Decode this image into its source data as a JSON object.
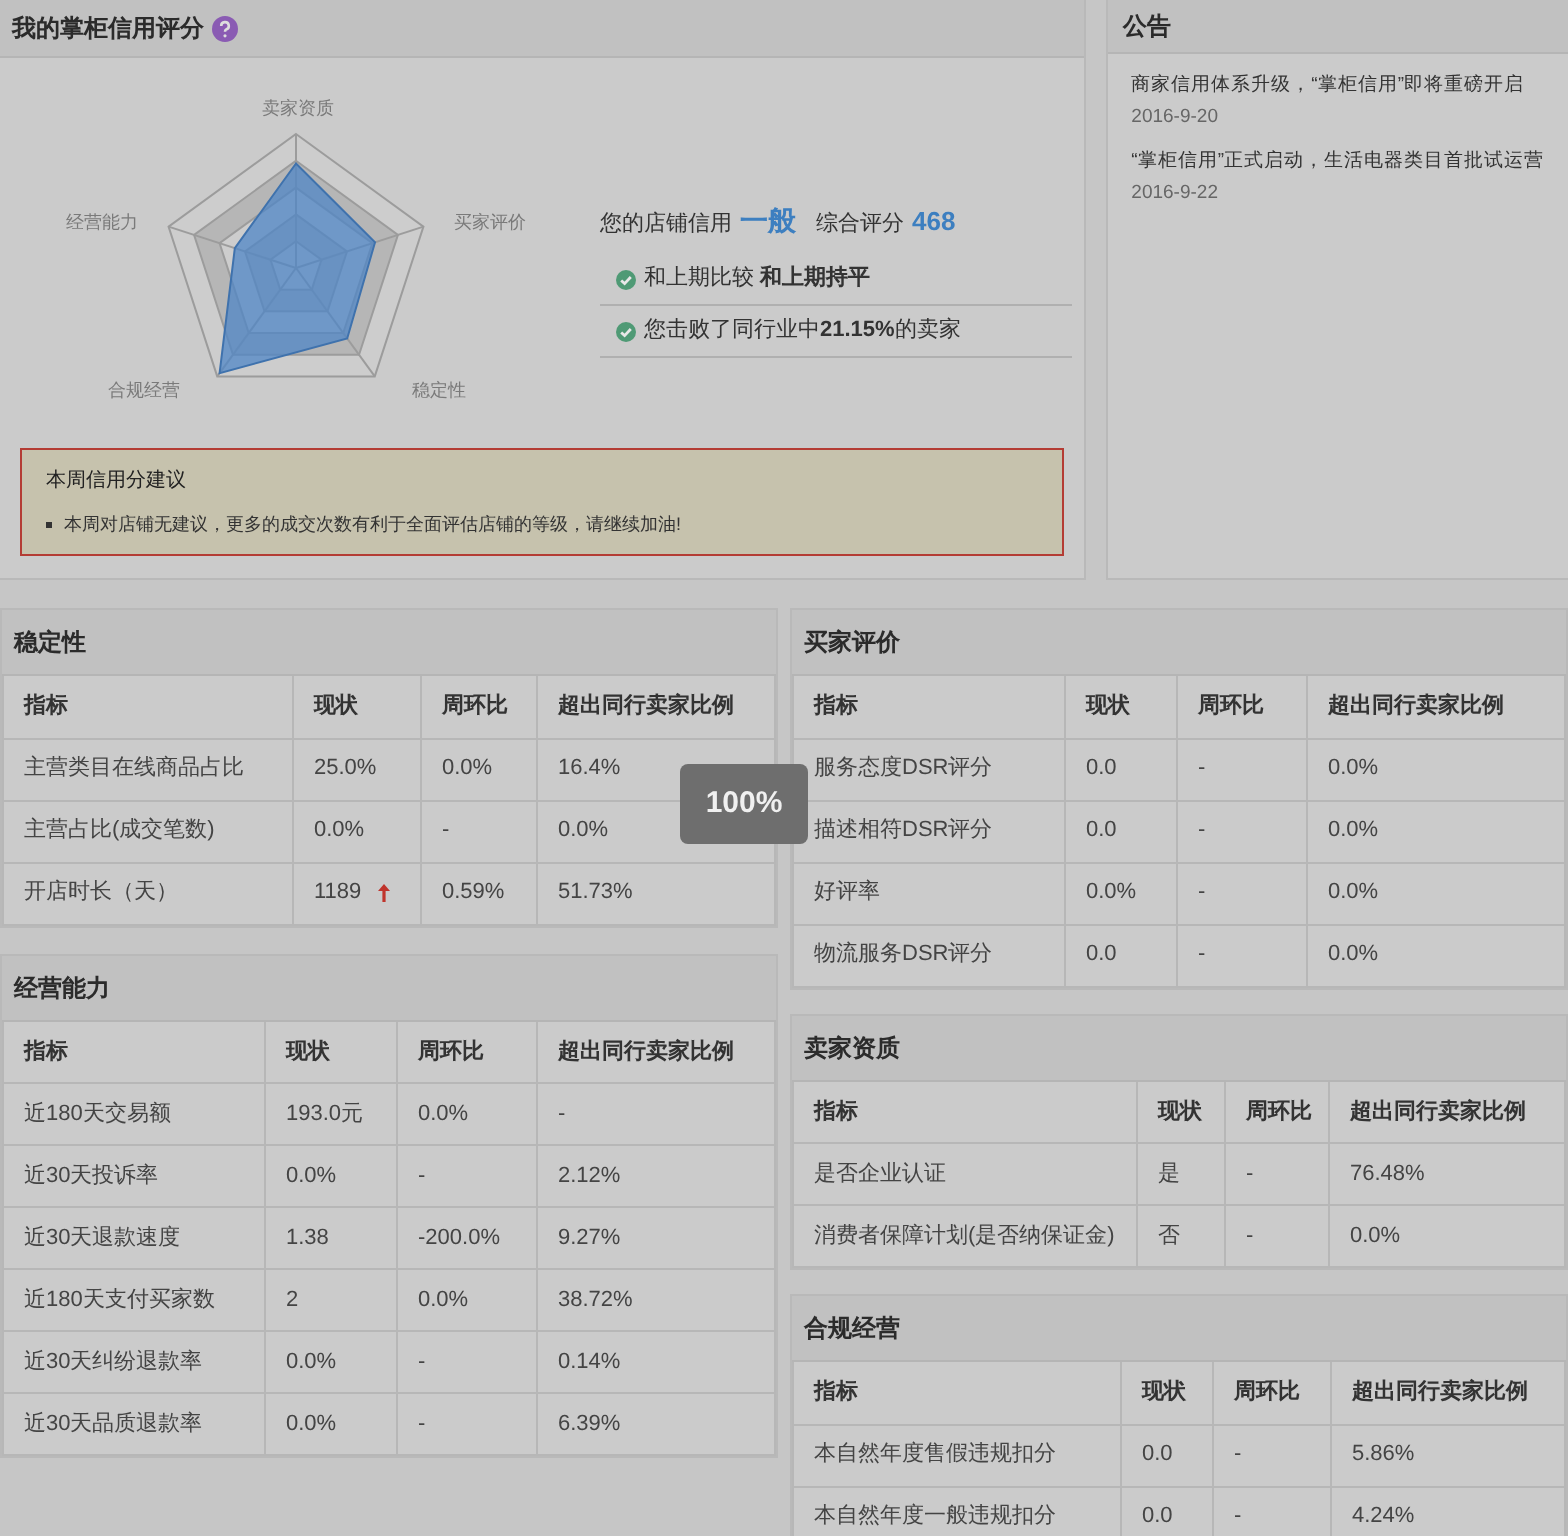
{
  "credit_panel": {
    "title": "我的掌柜信用评分",
    "radar_labels": [
      "卖家资质",
      "买家评价",
      "稳定性",
      "合规经营",
      "经营能力"
    ],
    "summary": {
      "label": "您的店铺信用",
      "level": "一般",
      "score_label": "综合评分",
      "score": "468"
    },
    "checks": [
      {
        "text": "和上期比较 **和上期持平**"
      },
      {
        "text": "您击败了同行业中**21.15%**的卖家"
      }
    ],
    "advice": {
      "title": "本周信用分建议",
      "items": [
        "本周对店铺无建议，更多的成交次数有利于全面评估店铺的等级，请继续加油!"
      ]
    }
  },
  "announcements": {
    "title": "公告",
    "items": [
      {
        "title": "商家信用体系升级，“掌柜信用”即将重磅开启",
        "date": "2016-9-20"
      },
      {
        "title": "“掌柜信用”正式启动，生活电器类目首批试运营",
        "date": "2016-9-22"
      }
    ]
  },
  "left_sections": [
    {
      "title": "稳定性",
      "columns": [
        "指标",
        "现状",
        "周环比",
        "超出同行卖家比例"
      ],
      "rows": [
        {
          "cells": [
            "主营类目在线商品占比",
            "25.0%",
            "0.0%",
            "16.4%"
          ]
        },
        {
          "cells": [
            "主营占比(成交笔数)",
            "0.0%",
            "-",
            "0.0%"
          ]
        },
        {
          "cells": [
            "开店时长（天）",
            "1189",
            "0.59%",
            "51.73%"
          ],
          "rising": true
        }
      ]
    },
    {
      "title": "经营能力",
      "columns": [
        "指标",
        "现状",
        "周环比",
        "超出同行卖家比例"
      ],
      "rows": [
        {
          "cells": [
            "近180天交易额",
            "193.0元",
            "0.0%",
            "-"
          ]
        },
        {
          "cells": [
            "近30天投诉率",
            "0.0%",
            "-",
            "2.12%"
          ]
        },
        {
          "cells": [
            "近30天退款速度",
            "1.38",
            "-200.0%",
            "9.27%"
          ]
        },
        {
          "cells": [
            "近180天支付买家数",
            "2",
            "0.0%",
            "38.72%"
          ]
        },
        {
          "cells": [
            "近30天纠纷退款率",
            "0.0%",
            "-",
            "0.14%"
          ]
        },
        {
          "cells": [
            "近30天品质退款率",
            "0.0%",
            "-",
            "6.39%"
          ]
        }
      ]
    }
  ],
  "right_sections": [
    {
      "title": "买家评价",
      "columns": [
        "指标",
        "现状",
        "周环比",
        "超出同行卖家比例"
      ],
      "rows": [
        {
          "cells": [
            "服务态度DSR评分",
            "0.0",
            "-",
            "0.0%"
          ]
        },
        {
          "cells": [
            "描述相符DSR评分",
            "0.0",
            "-",
            "0.0%"
          ]
        },
        {
          "cells": [
            "好评率",
            "0.0%",
            "-",
            "0.0%"
          ]
        },
        {
          "cells": [
            "物流服务DSR评分",
            "0.0",
            "-",
            "0.0%"
          ]
        }
      ]
    },
    {
      "title": "卖家资质",
      "columns": [
        "指标",
        "现状",
        "周环比",
        "超出同行卖家比例"
      ],
      "rows": [
        {
          "cells": [
            "是否企业认证",
            "是",
            "-",
            "76.48%"
          ]
        },
        {
          "cells": [
            "消费者保障计划(是否纳保证金)",
            "否",
            "-",
            "0.0%"
          ]
        }
      ]
    },
    {
      "title": "合规经营",
      "columns": [
        "指标",
        "现状",
        "周环比",
        "超出同行卖家比例"
      ],
      "rows": [
        {
          "cells": [
            "本自然年度售假违规扣分",
            "0.0",
            "-",
            "5.86%"
          ]
        },
        {
          "cells": [
            "本自然年度一般违规扣分",
            "0.0",
            "-",
            "4.24%"
          ]
        }
      ]
    }
  ],
  "zoom_indicator": "100%"
}
